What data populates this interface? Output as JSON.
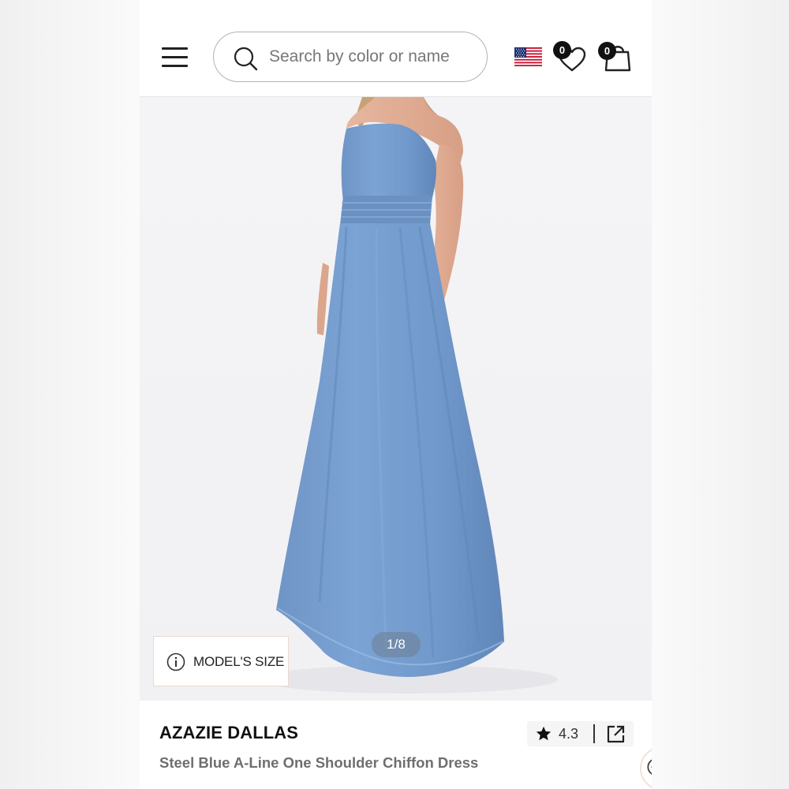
{
  "header": {
    "search": {
      "placeholder": "Search by color or name",
      "value": ""
    },
    "region_flag": "us-flag",
    "wishlist_count": "0",
    "cart_count": "0"
  },
  "gallery": {
    "model_size_label": "MODEL'S SIZE",
    "pager": "1/8",
    "dress_color": "#789fd0"
  },
  "product": {
    "brand": "AZAZIE DALLAS",
    "name": "Steel Blue A-Line One Shoulder Chiffon Dress",
    "rating": "4.3"
  },
  "icons": [
    "menu-icon",
    "search-icon",
    "us-flag-icon",
    "heart-icon",
    "shopping-bag-icon",
    "info-icon",
    "star-icon",
    "share-icon",
    "chat-icon"
  ]
}
